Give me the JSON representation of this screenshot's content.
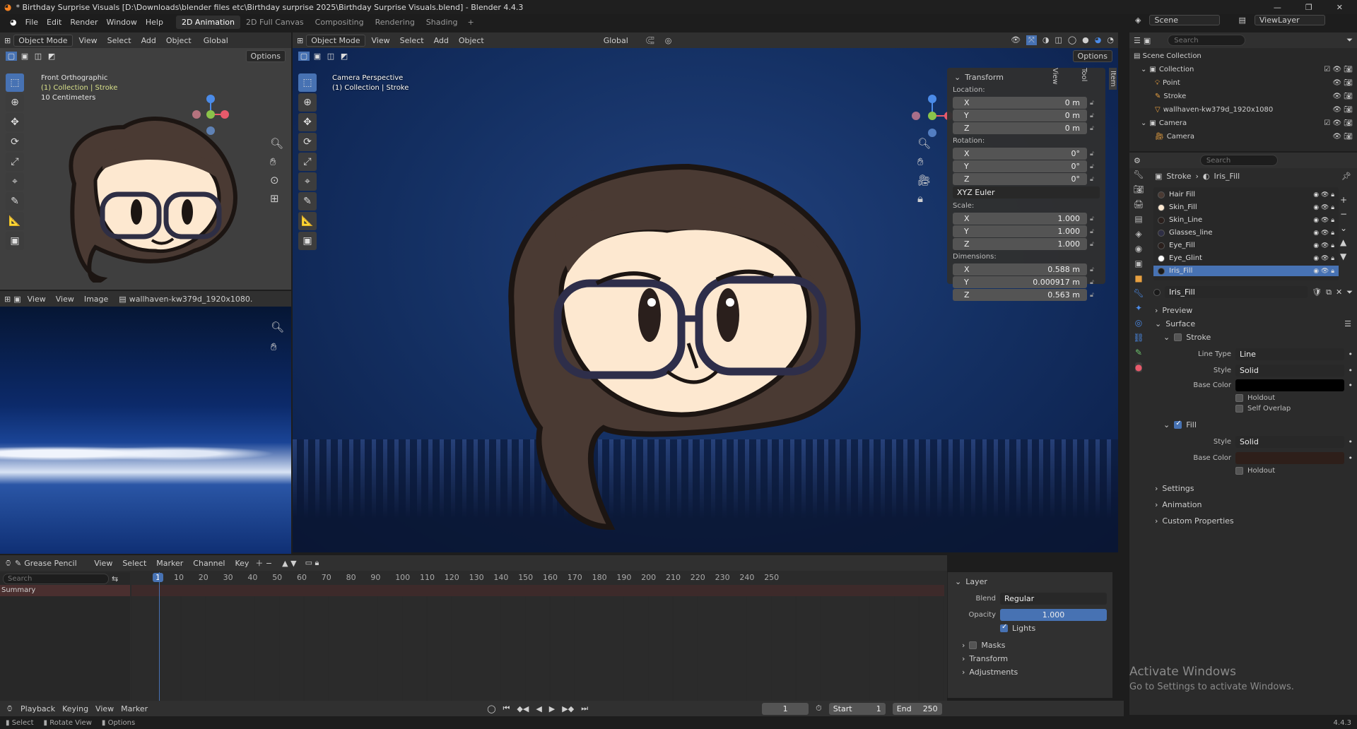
{
  "titlebar": {
    "title": "* Birthday Surprise Visuals [D:\\Downloads\\blender files etc\\Birthday surprise 2025\\Birthday Surprise Visuals.blend] - Blender 4.4.3",
    "minimize": "—",
    "maximize": "❐",
    "close": "✕"
  },
  "menubar": {
    "items": [
      "File",
      "Edit",
      "Render",
      "Window",
      "Help"
    ],
    "workspaces": [
      "2D Animation",
      "2D Full Canvas",
      "Compositing",
      "Rendering",
      "Shading"
    ],
    "add_tab": "+",
    "scene": "Scene",
    "view_layer": "ViewLayer"
  },
  "left_viewport": {
    "mode": "Object Mode",
    "menus": [
      "View",
      "Select",
      "Add",
      "Object"
    ],
    "orientation": "Global",
    "options": "Options",
    "overlay_lines": [
      "Front Orthographic",
      "(1) Collection | Stroke",
      "10 Centimeters"
    ]
  },
  "main_viewport": {
    "mode": "Object Mode",
    "menus": [
      "View",
      "Select",
      "Add",
      "Object"
    ],
    "orientation": "Global",
    "options": "Options",
    "overlay_lines": [
      "Camera Perspective",
      "(1) Collection | Stroke"
    ],
    "side_tabs": [
      "Item",
      "Tool",
      "View"
    ]
  },
  "transform_panel": {
    "title": "Transform",
    "location_label": "Location:",
    "rotation_label": "Rotation:",
    "scale_label": "Scale:",
    "dimensions_label": "Dimensions:",
    "euler": "XYZ Euler",
    "location": [
      {
        "axis": "X",
        "value": "0 m"
      },
      {
        "axis": "Y",
        "value": "0 m"
      },
      {
        "axis": "Z",
        "value": "0 m"
      }
    ],
    "rotation": [
      {
        "axis": "X",
        "value": "0°"
      },
      {
        "axis": "Y",
        "value": "0°"
      },
      {
        "axis": "Z",
        "value": "0°"
      }
    ],
    "scale": [
      {
        "axis": "X",
        "value": "1.000"
      },
      {
        "axis": "Y",
        "value": "1.000"
      },
      {
        "axis": "Z",
        "value": "1.000"
      }
    ],
    "dimensions": [
      {
        "axis": "X",
        "value": "0.588 m"
      },
      {
        "axis": "Y",
        "value": "0.000917 m"
      },
      {
        "axis": "Z",
        "value": "0.563 m"
      }
    ]
  },
  "image_editor": {
    "menus": [
      "View",
      "View",
      "Image"
    ],
    "image_name": "wallhaven-kw379d_1920x1080."
  },
  "outliner": {
    "search_placeholder": "Search",
    "scene_collection": "Scene Collection",
    "collection": "Collection",
    "items": [
      "Point",
      "Stroke",
      "wallhaven-kw379d_1920x1080",
      "Camera",
      "Camera"
    ]
  },
  "properties": {
    "search_placeholder": "Search",
    "breadcrumb": [
      "Stroke",
      "Iris_Fill"
    ],
    "materials": [
      {
        "name": "Hair Fill",
        "color": "#4a3a33"
      },
      {
        "name": "Skin_Fill",
        "color": "#fde8d0"
      },
      {
        "name": "Skin_Line",
        "color": "#2a1f1c"
      },
      {
        "name": "Glasses_line",
        "color": "#2e2e44"
      },
      {
        "name": "Eye_Fill",
        "color": "#2a1f1c"
      },
      {
        "name": "Eye_Glint",
        "color": "#ffffff"
      },
      {
        "name": "Iris_Fill",
        "color": "#1a1a1a"
      }
    ],
    "material_name": "Iris_Fill",
    "sections": {
      "preview": "Preview",
      "surface": "Surface",
      "stroke": "Stroke",
      "fill": "Fill",
      "settings": "Settings",
      "animation": "Animation",
      "custom": "Custom Properties"
    },
    "stroke": {
      "line_type_label": "Line Type",
      "line_type": "Line",
      "style_label": "Style",
      "style": "Solid",
      "base_color_label": "Base Color",
      "holdout": "Holdout",
      "self_overlap": "Self Overlap"
    },
    "fill": {
      "style_label": "Style",
      "style": "Solid",
      "base_color_label": "Base Color",
      "holdout": "Holdout"
    }
  },
  "dopesheet": {
    "mode": "Grease Pencil",
    "menus": [
      "View",
      "Select",
      "Marker",
      "Channel",
      "Key"
    ],
    "search_placeholder": "Search",
    "summary": "Summary",
    "current_frame": "1",
    "ticks": [
      "10",
      "20",
      "30",
      "40",
      "50",
      "60",
      "70",
      "80",
      "90",
      "100",
      "110",
      "120",
      "130",
      "140",
      "150",
      "160",
      "170",
      "180",
      "190",
      "200",
      "210",
      "220",
      "230",
      "240",
      "250"
    ]
  },
  "layer_panel": {
    "title": "Layer",
    "blend_label": "Blend",
    "blend": "Regular",
    "opacity_label": "Opacity",
    "opacity": "1.000",
    "opacity_fraction": 1.0,
    "lights": "Lights",
    "masks": "Masks",
    "transform": "Transform",
    "adjustments": "Adjustments"
  },
  "playback": {
    "menus": [
      "Playback",
      "Keying",
      "View",
      "Marker"
    ],
    "frame": "1",
    "start_label": "Start",
    "start": "1",
    "end_label": "End",
    "end": "250"
  },
  "statusbar": {
    "items": [
      "Select",
      "Rotate View",
      "Options"
    ],
    "version": "4.4.3"
  },
  "watermark": {
    "line1": "Activate Windows",
    "line2": "Go to Settings to activate Windows."
  },
  "colors": {
    "accent": "#4772b3",
    "panel": "#303030",
    "header": "#2b2b2b",
    "dark": "#1d1d1d"
  }
}
